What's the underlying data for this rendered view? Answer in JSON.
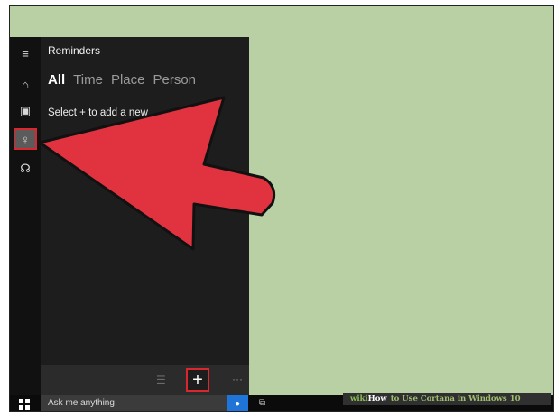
{
  "cortana": {
    "title": "Reminders",
    "tabs": [
      {
        "label": "All",
        "active": true
      },
      {
        "label": "Time",
        "active": false
      },
      {
        "label": "Place",
        "active": false
      },
      {
        "label": "Person",
        "active": false
      }
    ],
    "hint": "Select + to add a new",
    "add_label": "+",
    "more_label": "···"
  },
  "rail": {
    "items": [
      {
        "icon": "hamburger-menu-icon",
        "glyph": "≡"
      },
      {
        "icon": "home-icon",
        "glyph": "⌂"
      },
      {
        "icon": "notebook-icon",
        "glyph": "▣"
      },
      {
        "icon": "lightbulb-icon",
        "glyph": "♀",
        "active": true
      },
      {
        "icon": "feedback-icon",
        "glyph": "☊"
      }
    ]
  },
  "taskbar": {
    "search_placeholder": "Ask me anything",
    "mic_glyph": "●",
    "taskview_glyph": "⧉"
  },
  "watermark": {
    "wiki": "wiki",
    "how": "How",
    "rest": "to Use Cortana in Windows 10"
  },
  "colors": {
    "desktop": "#b9d0a4",
    "highlight": "#d9262f",
    "arrow_fill": "#e0333f",
    "accent": "#1f74d8"
  }
}
